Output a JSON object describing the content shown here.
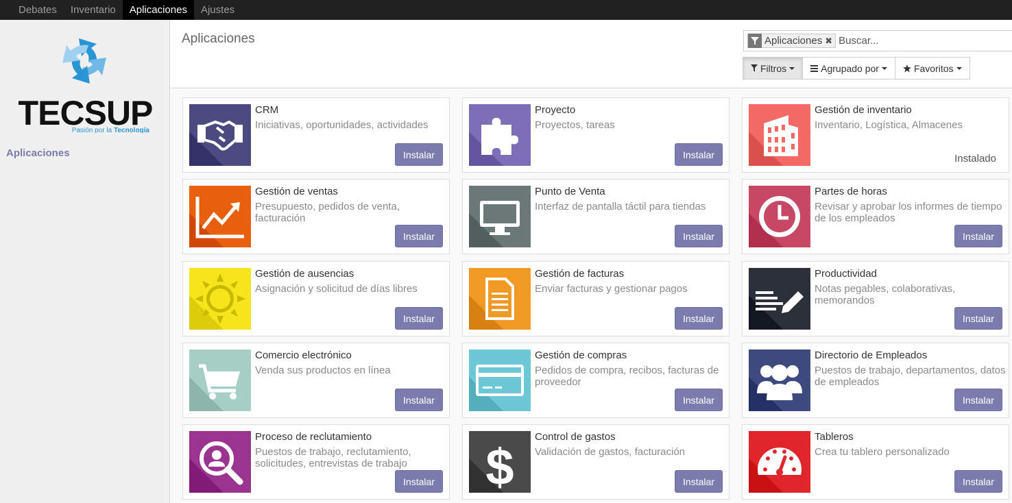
{
  "topnav": {
    "items": [
      {
        "label": "Debates",
        "active": false
      },
      {
        "label": "Inventario",
        "active": false
      },
      {
        "label": "Aplicaciones",
        "active": true
      },
      {
        "label": "Ajustes",
        "active": false
      }
    ]
  },
  "sidebar": {
    "logo_text": "TECSUP",
    "logo_tagline_1": "Pasión por la ",
    "logo_tagline_2": "Tecnología",
    "items": [
      {
        "label": "Aplicaciones"
      }
    ]
  },
  "control_panel": {
    "title": "Aplicaciones",
    "search": {
      "facet_label": "Aplicaciones",
      "facet_icon": "filter-icon",
      "placeholder": "Buscar..."
    },
    "buttons": [
      {
        "label": "Filtros",
        "icon": "filter-icon"
      },
      {
        "label": "Agrupado por",
        "icon": "bars-icon"
      },
      {
        "label": "Favoritos",
        "icon": "star-icon"
      }
    ]
  },
  "apps": [
    {
      "title": "CRM",
      "description": "Iniciativas, oportunidades, actividades",
      "action": "Instalar",
      "installed": false,
      "color": "#4c4a80",
      "icon": "handshake-icon"
    },
    {
      "title": "Proyecto",
      "description": "Proyectos, tareas",
      "action": "Instalar",
      "installed": false,
      "color": "#7c6fb8",
      "icon": "puzzle-icon"
    },
    {
      "title": "Gestión de inventario",
      "description": "Inventario, Logística, Almacenes",
      "action": "Instalado",
      "installed": true,
      "color": "#f26a63",
      "icon": "building-icon"
    },
    {
      "title": "Gestión de ventas",
      "description": "Presupuesto, pedidos de venta, facturación",
      "action": "Instalar",
      "installed": false,
      "color": "#e8600e",
      "icon": "chart-line-icon"
    },
    {
      "title": "Punto de Venta",
      "description": "Interfaz de pantalla táctil para tiendas",
      "action": "Instalar",
      "installed": false,
      "color": "#6c7778",
      "icon": "monitor-icon"
    },
    {
      "title": "Partes de horas",
      "description": "Revisar y aprobar los informes de tiempo de los empleados",
      "action": "Instalar",
      "installed": false,
      "color": "#c74865",
      "icon": "clock-icon"
    },
    {
      "title": "Gestión de ausencias",
      "description": "Asignación y solicitud de días libres",
      "action": "Instalar",
      "installed": false,
      "color": "#f6e51c",
      "icon": "sun-icon"
    },
    {
      "title": "Gestión de facturas",
      "description": "Enviar facturas y gestionar pagos",
      "action": "Instalar",
      "installed": false,
      "color": "#ef9a25",
      "icon": "document-icon"
    },
    {
      "title": "Productividad",
      "description": "Notas pegables, colaborativas, memorandos",
      "action": "Instalar",
      "installed": false,
      "color": "#2b303a",
      "icon": "notes-pencil-icon"
    },
    {
      "title": "Comercio electrónico",
      "description": "Venda sus productos en línea",
      "action": "Instalar",
      "installed": false,
      "color": "#a5cec5",
      "icon": "cart-icon"
    },
    {
      "title": "Gestión de compras",
      "description": "Pedidos de compra, recibos, facturas de proveedor",
      "action": "Instalar",
      "installed": false,
      "color": "#6dc8d6",
      "icon": "credit-card-icon"
    },
    {
      "title": "Directorio de Empleados",
      "description": "Puestos de trabajo, departamentos, datos de empleados",
      "action": "Instalar",
      "installed": false,
      "color": "#3c4a7e",
      "icon": "users-icon"
    },
    {
      "title": "Proceso de reclutamiento",
      "description": "Puestos de trabajo, reclutamiento, solicitudes, entrevistas de trabajo",
      "action": "Instalar",
      "installed": false,
      "color": "#9b3390",
      "icon": "search-person-icon"
    },
    {
      "title": "Control de gastos",
      "description": "Validación de gastos, facturación",
      "action": "Instalar",
      "installed": false,
      "color": "#4a4a4a",
      "icon": "dollar-icon"
    },
    {
      "title": "Tableros",
      "description": "Crea tu tablero personalizado",
      "action": "Instalar",
      "installed": false,
      "color": "#e0262a",
      "icon": "dashboard-icon"
    }
  ]
}
